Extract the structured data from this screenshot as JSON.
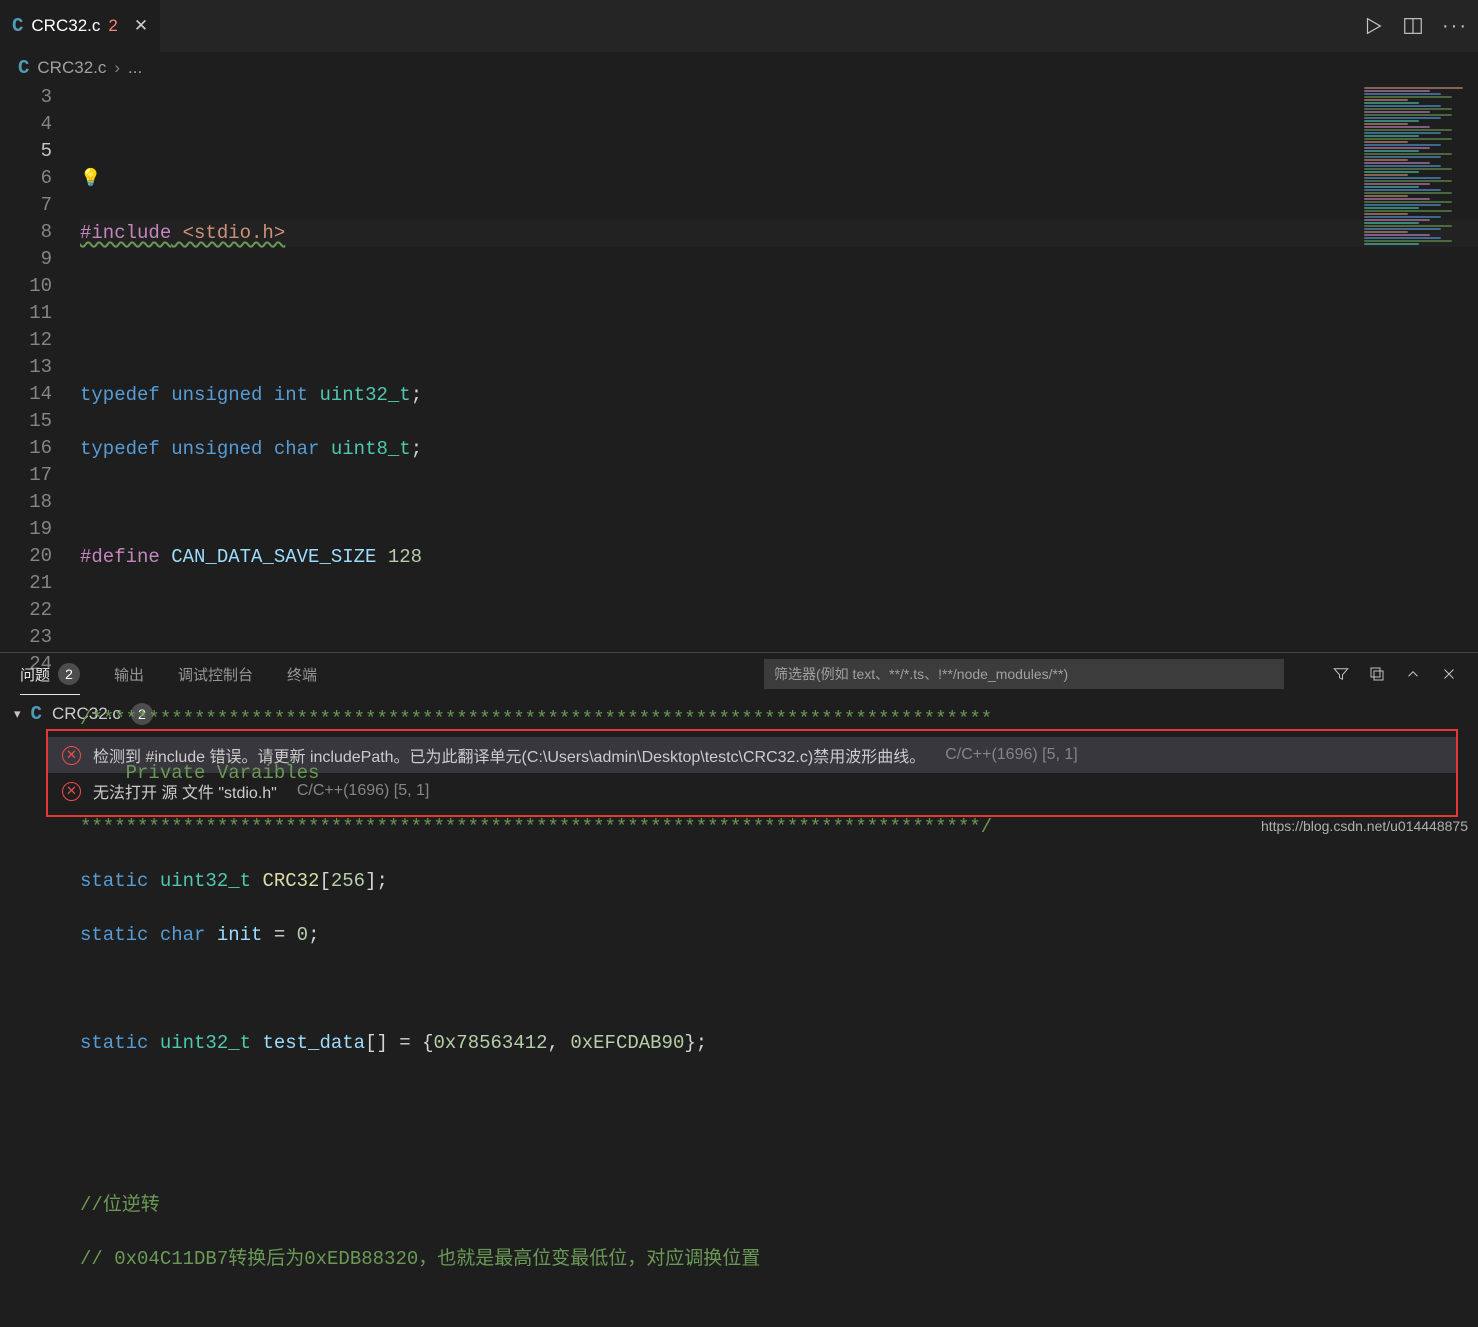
{
  "tab": {
    "icon_letter": "C",
    "filename": "CRC32.c",
    "modified_indicator": "2",
    "close": "✕"
  },
  "tab_actions": {
    "ellipsis": "···"
  },
  "breadcrumb": {
    "icon_letter": "C",
    "filename": "CRC32.c",
    "sep": "›",
    "rest": "..."
  },
  "lines": {
    "l3": "",
    "l5_include": "#include",
    "l5_header": " <stdio.h>",
    "l8_typedef": "typedef",
    "l8_unsigned": " unsigned",
    "l8_int": " int",
    "l8_type": " uint32_t",
    "l8_semi": ";",
    "l9_typedef": "typedef",
    "l9_unsigned": " unsigned",
    "l9_char": " char",
    "l9_type": " uint8_t",
    "l9_semi": ";",
    "l11_define": "#define",
    "l11_name": " CAN_DATA_SAVE_SIZE",
    "l11_val": " 128",
    "l14": "/*******************************************************************************",
    "l15": "    Private Varaibles",
    "l16": "*******************************************************************************/",
    "l17_static": "static",
    "l17_type": " uint32_t",
    "l17_name": " CRC32",
    "l17_rest": "[",
    "l17_num": "256",
    "l17_end": "];",
    "l18_static": "static",
    "l18_char": " char",
    "l18_name": " init",
    "l18_eq": " = ",
    "l18_num": "0",
    "l18_semi": ";",
    "l20_static": "static",
    "l20_type": " uint32_t",
    "l20_name": " test_data",
    "l20_br": "[] = {",
    "l20_n1": "0x78563412",
    "l20_c": ", ",
    "l20_n2": "0xEFCDAB90",
    "l20_end": "};",
    "l23": "//位逆转",
    "l24": "// 0x04C11DB7转换后为0xEDB88320，也就是最高位变最低位，对应调换位置"
  },
  "line_numbers": [
    "3",
    "4",
    "5",
    "6",
    "7",
    "8",
    "9",
    "10",
    "11",
    "12",
    "13",
    "14",
    "15",
    "16",
    "17",
    "18",
    "19",
    "20",
    "21",
    "22",
    "23",
    "24"
  ],
  "active_line": "5",
  "panel": {
    "tabs": {
      "problems": "问题",
      "problems_count": "2",
      "output": "输出",
      "debug": "调试控制台",
      "terminal": "终端"
    },
    "filter_placeholder": "筛选器(例如 text、**/*.ts、!**/node_modules/**)",
    "file": {
      "name": "CRC32.c",
      "count": "2"
    },
    "errors": [
      {
        "msg": "检测到 #include 错误。请更新 includePath。已为此翻译单元(C:\\Users\\admin\\Desktop\\testc\\CRC32.c)禁用波形曲线。",
        "source": "C/C++(1696)  [5, 1]"
      },
      {
        "msg": "无法打开 源 文件 \"stdio.h\"",
        "source": "C/C++(1696)  [5, 1]"
      }
    ]
  },
  "watermark": "https://blog.csdn.net/u014448875"
}
